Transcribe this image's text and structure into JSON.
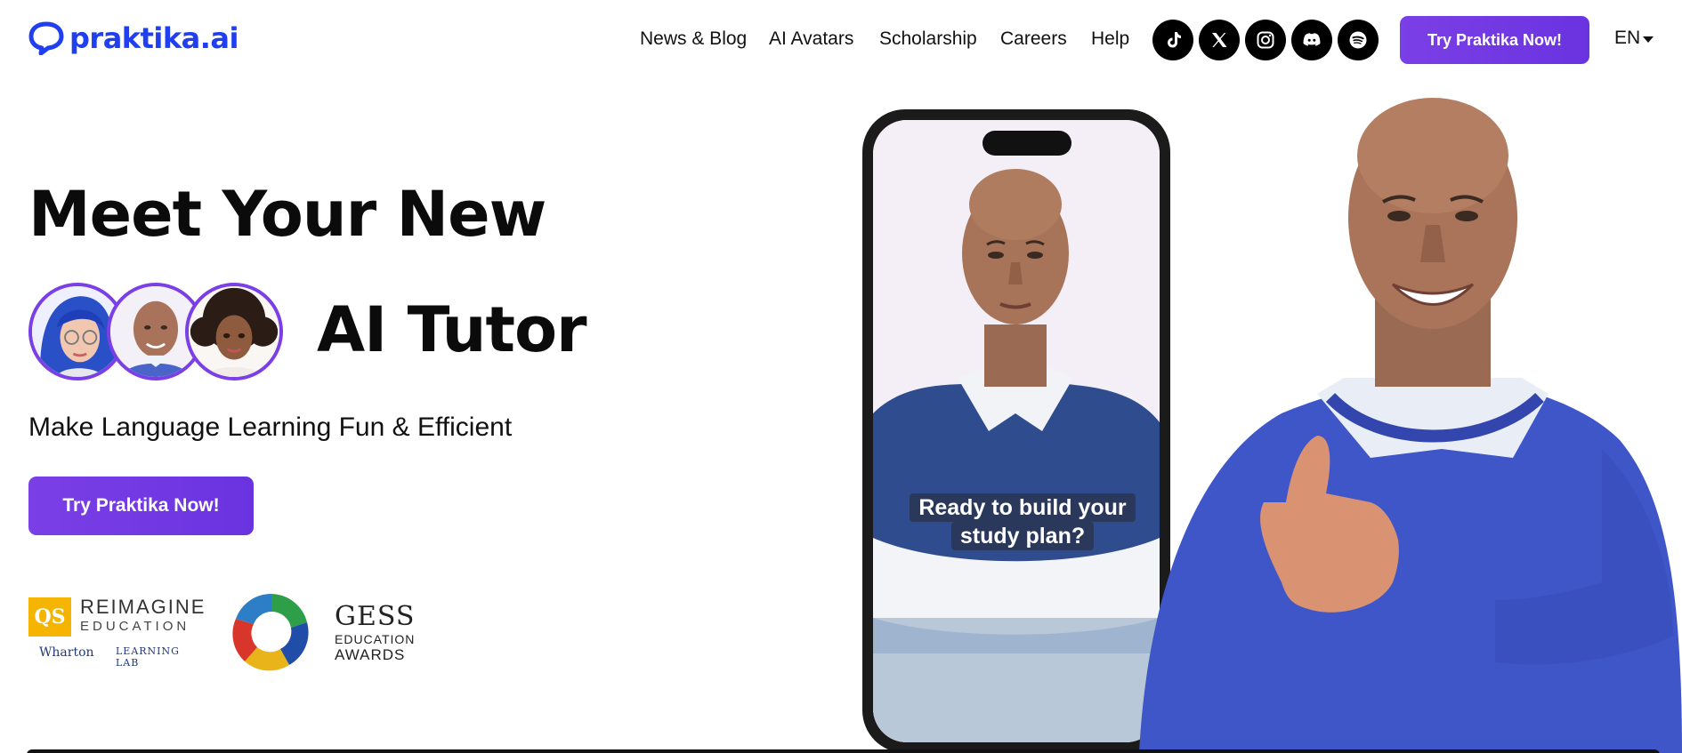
{
  "header": {
    "logo_text": "praktika.ai",
    "nav": [
      {
        "label": "News & Blog"
      },
      {
        "label": "AI Avatars"
      },
      {
        "label": "Scholarship"
      },
      {
        "label": "Careers"
      },
      {
        "label": "Help"
      }
    ],
    "social_icons": [
      "tiktok-icon",
      "x-icon",
      "instagram-icon",
      "discord-icon",
      "spotify-icon"
    ],
    "cta_label": "Try Praktika Now!",
    "language": "EN"
  },
  "hero": {
    "title_line1": "Meet Your New",
    "title_line2": "AI Tutor",
    "subtitle": "Make Language Learning Fun & Efficient",
    "cta_label": "Try Praktika Now!",
    "avatars": [
      "blue-haired-avatar",
      "bald-man-avatar",
      "curly-haired-avatar"
    ]
  },
  "awards": {
    "qs": {
      "badge": "QS",
      "line1": "REIMAGINE",
      "line2": "EDUCATION",
      "line3": "Wharton",
      "line4": "LEARNING LAB"
    },
    "gess": {
      "line1": "GESS",
      "line2": "EDUCATION",
      "line3": "AWARDS"
    }
  },
  "phone": {
    "caption_line1": "Ready to build your",
    "caption_line2": "study plan?"
  },
  "colors": {
    "brand_blue": "#1f3ff0",
    "accent_purple": "#7b3fe6"
  }
}
